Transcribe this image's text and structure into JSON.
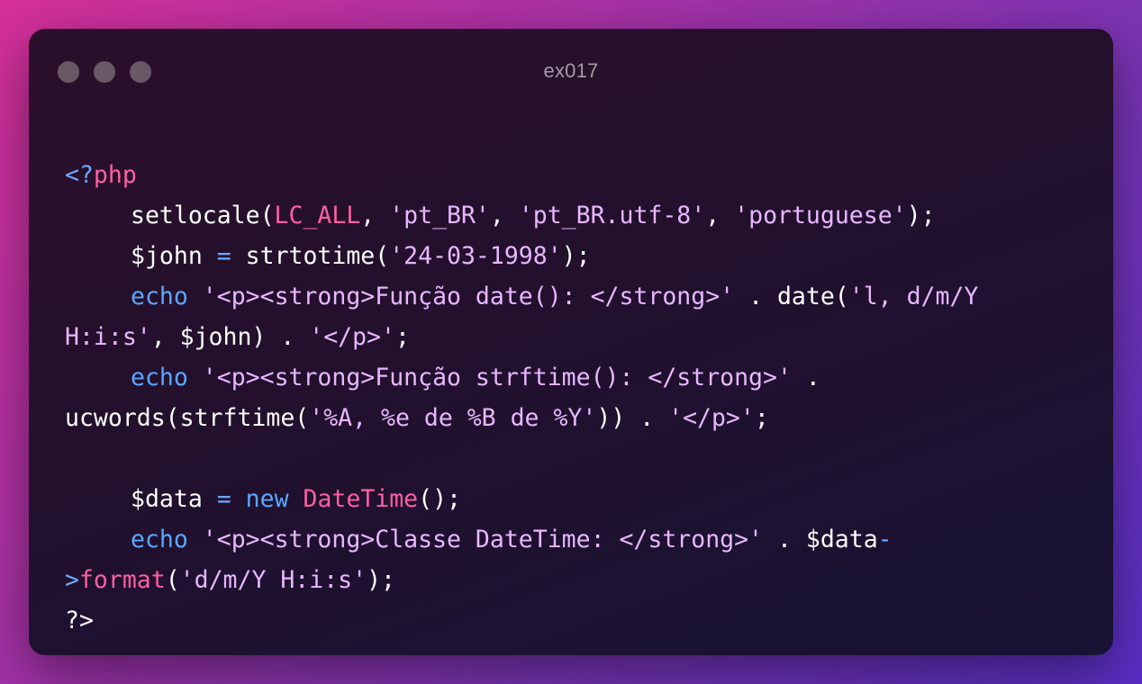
{
  "window": {
    "title": "ex017"
  },
  "code": {
    "lines": [
      [
        {
          "t": "<?",
          "c": "tok-op"
        },
        {
          "t": "php",
          "c": "tok-php"
        }
      ],
      [
        {
          "t": "setlocale(",
          "c": "tok-plain"
        },
        {
          "t": "LC_ALL",
          "c": "tok-const"
        },
        {
          "t": ", ",
          "c": "tok-plain"
        },
        {
          "t": "'pt_BR'",
          "c": "tok-str"
        },
        {
          "t": ", ",
          "c": "tok-plain"
        },
        {
          "t": "'pt_BR.utf-8'",
          "c": "tok-str"
        },
        {
          "t": ", ",
          "c": "tok-plain"
        },
        {
          "t": "'portuguese'",
          "c": "tok-str"
        },
        {
          "t": ");",
          "c": "tok-plain"
        }
      ],
      [
        {
          "t": "$john",
          "c": "tok-var"
        },
        {
          "t": " = ",
          "c": "tok-op"
        },
        {
          "t": "strtotime(",
          "c": "tok-plain"
        },
        {
          "t": "'24-03-1998'",
          "c": "tok-str"
        },
        {
          "t": ");",
          "c": "tok-plain"
        }
      ],
      [
        {
          "t": "echo",
          "c": "tok-kw"
        },
        {
          "t": " ",
          "c": "tok-plain"
        },
        {
          "t": "'<p><strong>Função date(): </strong>'",
          "c": "tok-str"
        },
        {
          "t": " . date(",
          "c": "tok-plain"
        },
        {
          "t": "'l, d/m/Y",
          "c": "tok-str"
        }
      ],
      [
        {
          "t": "H:i:s'",
          "c": "tok-str"
        },
        {
          "t": ", $john) . ",
          "c": "tok-plain"
        },
        {
          "t": "'</p>'",
          "c": "tok-str"
        },
        {
          "t": ";",
          "c": "tok-plain"
        }
      ],
      [
        {
          "t": "echo",
          "c": "tok-kw"
        },
        {
          "t": " ",
          "c": "tok-plain"
        },
        {
          "t": "'<p><strong>Função strftime(): </strong>'",
          "c": "tok-str"
        },
        {
          "t": " .",
          "c": "tok-plain"
        }
      ],
      [
        {
          "t": "ucwords(strftime(",
          "c": "tok-plain"
        },
        {
          "t": "'%A, %e de %B de %Y'",
          "c": "tok-str"
        },
        {
          "t": ")) . ",
          "c": "tok-plain"
        },
        {
          "t": "'</p>'",
          "c": "tok-str"
        },
        {
          "t": ";",
          "c": "tok-plain"
        }
      ],
      [],
      [
        {
          "t": "$data",
          "c": "tok-var"
        },
        {
          "t": " = ",
          "c": "tok-op"
        },
        {
          "t": "new",
          "c": "tok-kw"
        },
        {
          "t": " ",
          "c": "tok-plain"
        },
        {
          "t": "DateTime",
          "c": "tok-cls"
        },
        {
          "t": "();",
          "c": "tok-plain"
        }
      ],
      [
        {
          "t": "echo",
          "c": "tok-kw"
        },
        {
          "t": " ",
          "c": "tok-plain"
        },
        {
          "t": "'<p><strong>Classe DateTime: </strong>'",
          "c": "tok-str"
        },
        {
          "t": " . $data",
          "c": "tok-plain"
        },
        {
          "t": "-",
          "c": "tok-op"
        }
      ],
      [
        {
          "t": ">",
          "c": "tok-op"
        },
        {
          "t": "format",
          "c": "tok-cls"
        },
        {
          "t": "(",
          "c": "tok-plain"
        },
        {
          "t": "'d/m/Y H:i:s'",
          "c": "tok-str"
        },
        {
          "t": ");",
          "c": "tok-plain"
        }
      ],
      [
        {
          "t": "?>",
          "c": "tok-plain"
        }
      ]
    ],
    "indented": [
      false,
      true,
      true,
      true,
      false,
      true,
      false,
      false,
      true,
      true,
      false,
      false
    ]
  }
}
